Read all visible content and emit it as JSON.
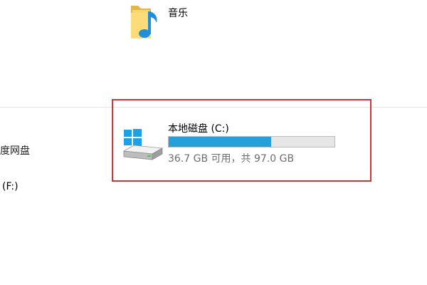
{
  "music_folder": {
    "label": "音乐",
    "icon": "music-folder-icon"
  },
  "sidebar": {
    "items": [
      {
        "label": "度网盘",
        "icon": ""
      },
      {
        "label": "(F:)",
        "icon": ""
      }
    ]
  },
  "drive": {
    "title": "本地磁盘 (C:)",
    "space_text": "36.7 GB 可用，共 97.0 GB",
    "used_fraction": 0.62,
    "icon": "windows-drive-icon",
    "bar_color": "#26a0da"
  },
  "highlight": {
    "color": "#d0343d"
  }
}
